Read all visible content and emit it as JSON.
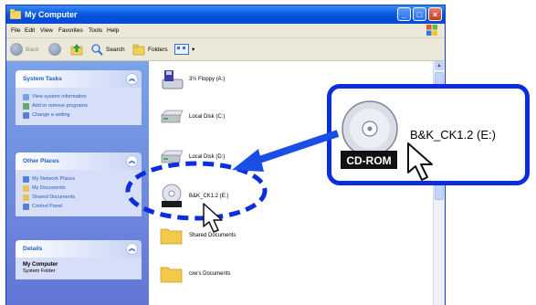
{
  "window": {
    "title": "My Computer",
    "controls": [
      "minimize",
      "maximize",
      "close"
    ]
  },
  "menubar": {
    "items": [
      "File",
      "Edit",
      "View",
      "Favorites",
      "Tools",
      "Help"
    ]
  },
  "toolbar": {
    "back_label": "Back",
    "search_label": "Search",
    "folders_label": "Folders"
  },
  "taskpane": {
    "system_tasks": {
      "title": "System Tasks",
      "items": [
        "View system information",
        "Add or remove programs",
        "Change a setting"
      ]
    },
    "other_places": {
      "title": "Other Places",
      "items": [
        "My Network Places",
        "My Documents",
        "Shared Documents",
        "Control Panel"
      ]
    },
    "details": {
      "title": "Details",
      "name": "My Computer",
      "subtitle": "System Folder"
    }
  },
  "files": {
    "items": [
      {
        "label": "3½ Floppy (A:)",
        "icon": "floppy-drive-icon"
      },
      {
        "label": "Local Disk (C:)",
        "icon": "hard-disk-icon"
      },
      {
        "label": "Local Disk (D:)",
        "icon": "hard-disk-icon"
      },
      {
        "label": "B&K_CK1.2 (E:)",
        "icon": "cd-rom-icon"
      },
      {
        "label": "Shared Documents",
        "icon": "folder-icon"
      },
      {
        "label": "cxe's Documents",
        "icon": "folder-icon"
      }
    ]
  },
  "callout": {
    "drive_label": "B&K_CK1.2 (E:)",
    "cd_badge": "CD-ROM"
  },
  "colors": {
    "callout_border": "#0c2ddf",
    "highlight_ellipse": "#0c2ddf",
    "arrow": "#1a4fe6",
    "titlebar": "#0a5ce3",
    "taskpane": "#6f8ddf"
  }
}
